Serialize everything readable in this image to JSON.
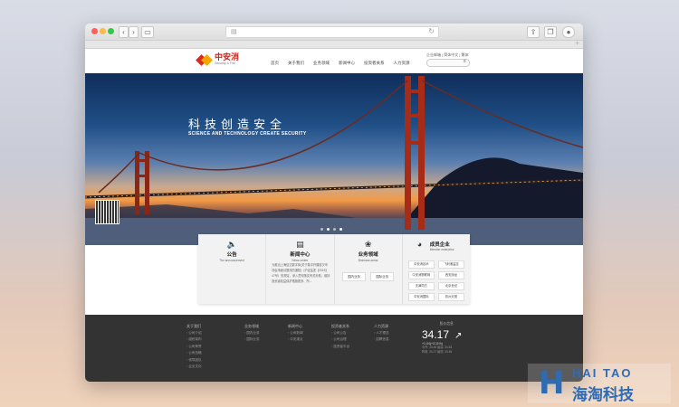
{
  "browser": {
    "url_icon": "document-icon",
    "reload_icon": "reload-icon",
    "back_label": "‹",
    "forward_label": "›",
    "sidebar_label": "▭",
    "share_label": "⇪",
    "tabs_label": "❐",
    "extension_label": "●",
    "new_tab_label": "+"
  },
  "site": {
    "logo_cn": "中安消",
    "logo_en": "Security & Fire",
    "nav": [
      "首页",
      "关于我们",
      "业务领域",
      "新闻中心",
      "投资者关系",
      "人力资源"
    ],
    "top_links": "企业邮箱 | 简体中文 | 繁体",
    "search_icon": "search-icon"
  },
  "hero": {
    "title": "科技创造安全",
    "subtitle": "SCIENCE AND TECHNOLOGY CREATE SECURITY"
  },
  "panels": {
    "announcement": {
      "title": "公告",
      "en": "The announcement",
      "icon": "speaker-icon"
    },
    "news": {
      "title": "新闻中心",
      "en": "News center",
      "icon": "document-icon",
      "text": "为推出上海信达数字体(关于集中开展首次市场会场面请整改的通知)（沪证监发【2015】47号）的规定，深入贯彻落实有关补助，维持投资者权益保护措施更多、所..."
    },
    "business": {
      "title": "业务领域",
      "en": "Business areas",
      "icon": "group-icon",
      "btn1": "国内业务",
      "btn2": "国际业务"
    },
    "members": {
      "title": "成员企业",
      "en": "Member enterprise",
      "icon": "globe-icon",
      "items": [
        "中安消技术",
        "飞利浦监控",
        "中安消物联网",
        "西安旭龙",
        "天津同方",
        "北京世纪",
        "中安消国际",
        "杭州天视"
      ]
    }
  },
  "footer": {
    "cols": [
      {
        "head": "关于我们",
        "items": [
          "公司介绍",
          "组织架构",
          "公司荣誉",
          "公司战略",
          "领导团队",
          "企业文化"
        ]
      },
      {
        "head": "业务领域",
        "items": [
          "国内业务",
          "国际业务"
        ]
      },
      {
        "head": "新闻中心",
        "items": [
          "公司新闻",
          "中安观点"
        ]
      },
      {
        "head": "投资者关系",
        "items": [
          "公司公告",
          "公司治理",
          "投资者平台"
        ]
      },
      {
        "head": "人力资源",
        "items": [
          "人才理念",
          "招聘信息"
        ]
      }
    ],
    "stock": {
      "label": "股价信息",
      "price": "34.17",
      "change": "+1.04(+3.11%)",
      "row1": "今开: 33.48   最高: 34.53",
      "row2": "昨收: 34.27   最低: 33.48"
    }
  },
  "watermark": {
    "en": "HAI TAO",
    "cn": "海淘科技",
    "letter": "H"
  }
}
